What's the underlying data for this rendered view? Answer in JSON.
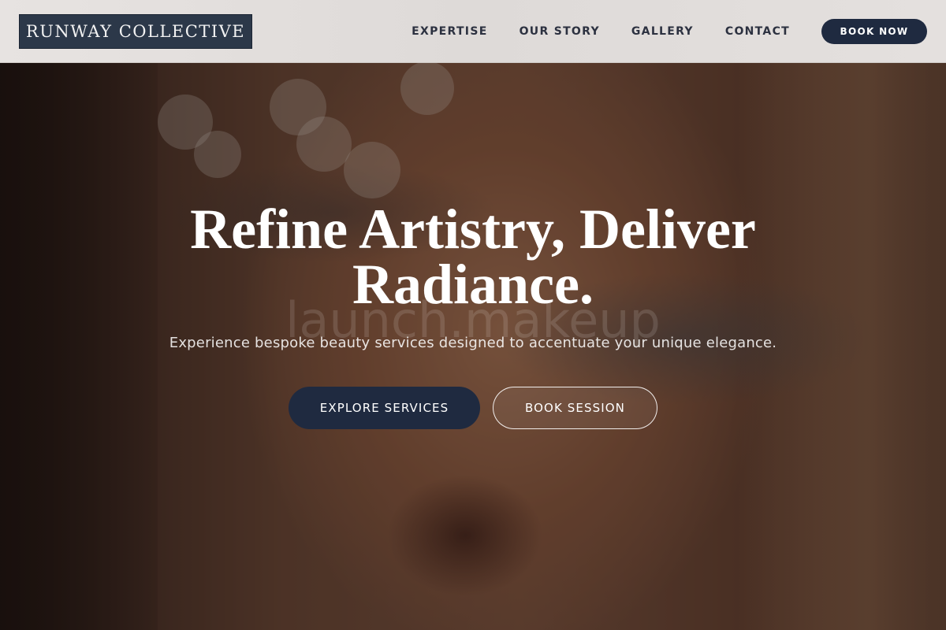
{
  "brand": {
    "name": "RUNWAY COLLECTIVE"
  },
  "nav": {
    "links": [
      "EXPERTISE",
      "OUR STORY",
      "GALLERY",
      "CONTACT"
    ],
    "cta": "BOOK NOW"
  },
  "hero": {
    "title_line1": "Refine Artistry, Deliver",
    "title_line2": "Radiance.",
    "subtitle": "Experience bespoke beauty services designed to accentuate your unique elegance.",
    "watermark": "launch.makeup",
    "primary_button": "EXPLORE SERVICES",
    "secondary_button": "BOOK SESSION",
    "background_image": "portrait-photo"
  },
  "colors": {
    "navy": "#1f2a40",
    "logo_bg": "#2c3849",
    "nav_bg": "#e2dedc",
    "nav_text": "#2c3140"
  }
}
